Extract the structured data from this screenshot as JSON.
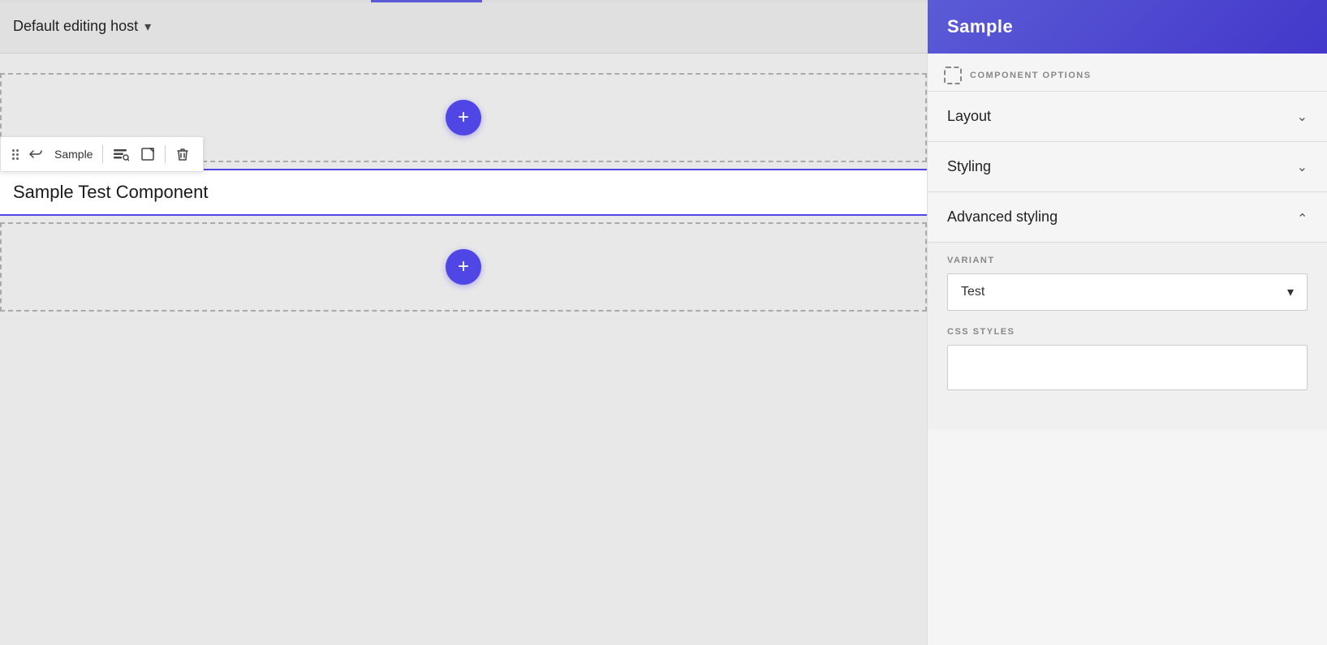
{
  "top_bar": {
    "title": "Default editing host",
    "chevron": "▾"
  },
  "canvas": {
    "add_btn_label": "+",
    "component_text": "Sample Test Component",
    "component_name": "Sample"
  },
  "toolbar": {
    "drag_label": "⠿",
    "back_icon": "↩",
    "component_label": "Sample",
    "search_icon": "⊟",
    "edit_icon": "⧉",
    "delete_icon": "🗑"
  },
  "right_panel": {
    "header_title": "Sample",
    "component_options_label": "COMPONENT OPTIONS",
    "sections": [
      {
        "id": "layout",
        "label": "Layout",
        "expanded": false
      },
      {
        "id": "styling",
        "label": "Styling",
        "expanded": false
      },
      {
        "id": "advanced_styling",
        "label": "Advanced styling",
        "expanded": true
      }
    ],
    "advanced_styling": {
      "variant_label": "VARIANT",
      "variant_value": "Test",
      "variant_chevron": "▾",
      "css_styles_label": "CSS STYLES",
      "css_styles_value": ""
    }
  }
}
